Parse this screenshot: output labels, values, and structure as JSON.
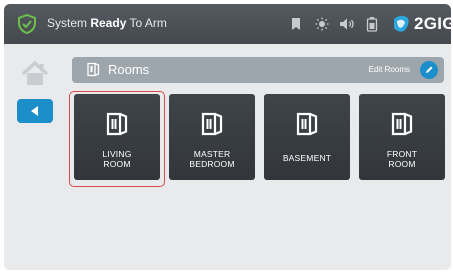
{
  "status": {
    "prefix": "System ",
    "state": "Ready",
    "suffix": " To Arm"
  },
  "top_icons": [
    "bookmark-icon",
    "brightness-icon",
    "volume-icon",
    "battery-icon"
  ],
  "brand": {
    "name": "2GIG"
  },
  "rooms_header": {
    "title": "Rooms",
    "edit_label": "Edit Rooms"
  },
  "rooms": [
    {
      "label": "LIVING\nROOM",
      "selected": true
    },
    {
      "label": "MASTER\nBEDROOM",
      "selected": false
    },
    {
      "label": "BASEMENT",
      "selected": false
    },
    {
      "label": "FRONT\nROOM",
      "selected": false
    }
  ],
  "colors": {
    "accent": "#1c8fcb",
    "status_ok": "#6cc04a",
    "tile": "#3a3e43",
    "selection": "#d84a4f"
  }
}
